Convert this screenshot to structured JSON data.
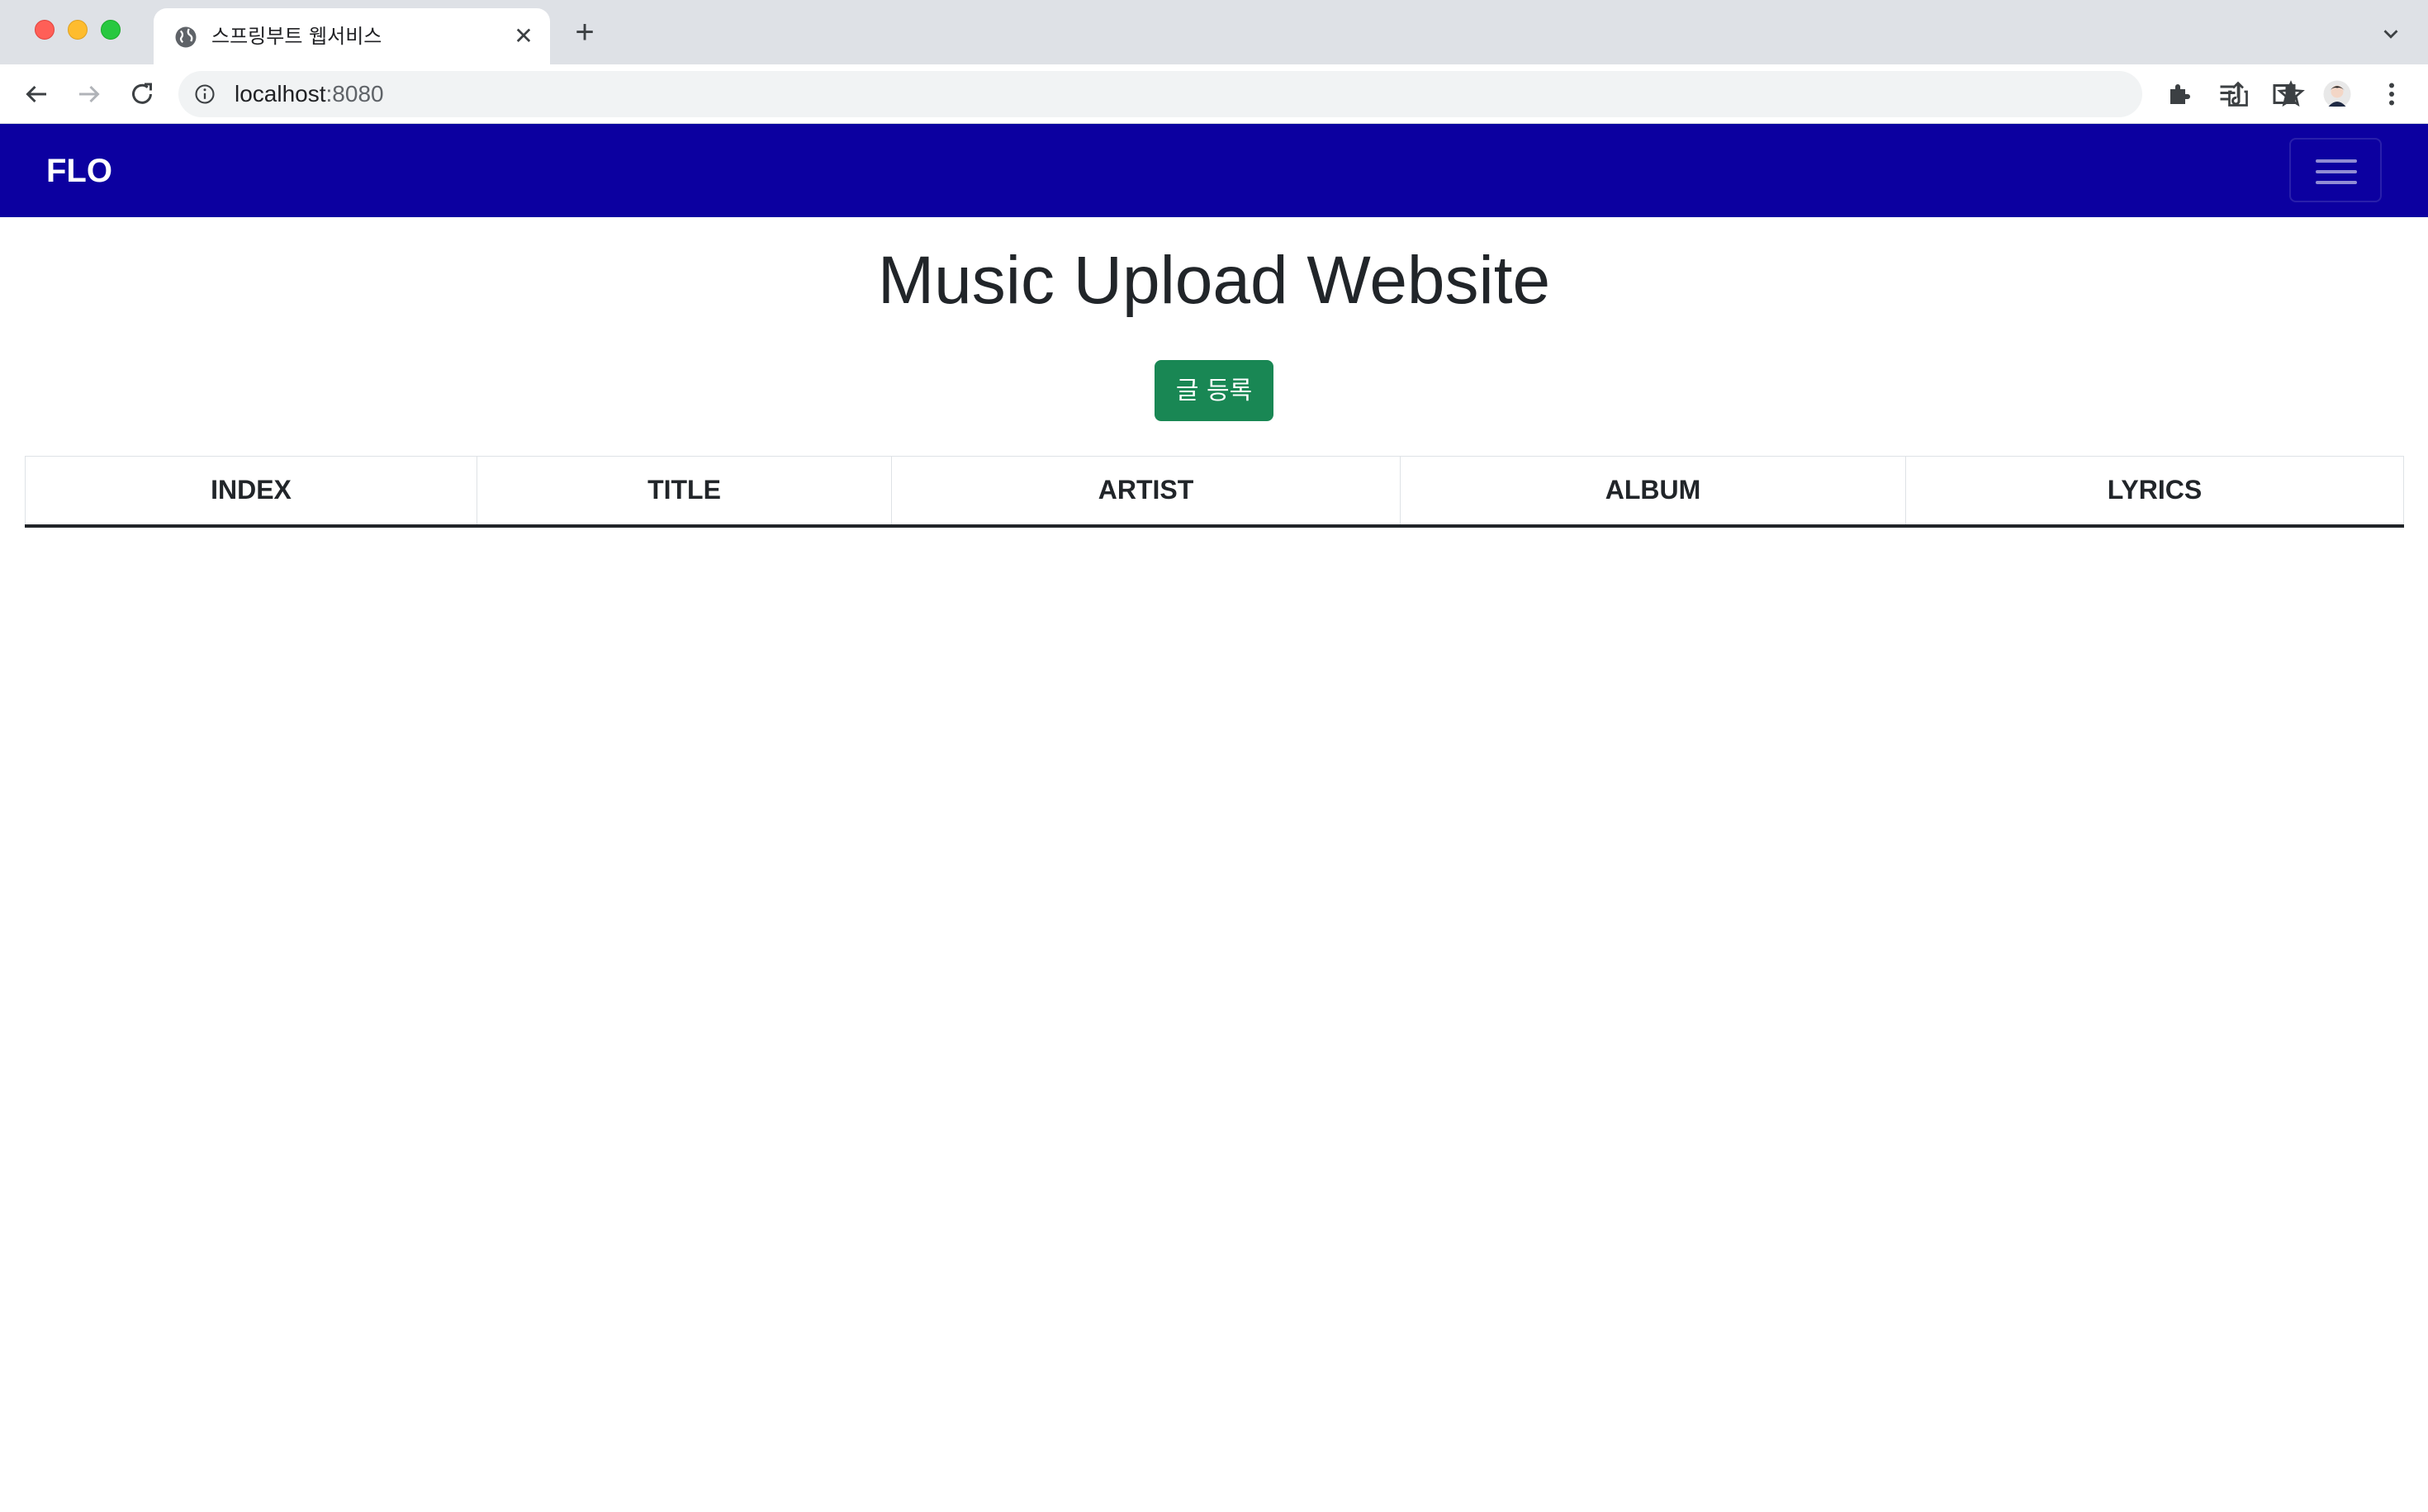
{
  "browser": {
    "tab_title": "스프링부트 웹서비스",
    "url_host": "localhost",
    "url_port": ":8080"
  },
  "navbar": {
    "brand": "FLO",
    "bg_color": "#0c00a0"
  },
  "main": {
    "title": "Music Upload Website",
    "add_button_label": "글 등록",
    "add_button_color": "#198754"
  },
  "table": {
    "columns": [
      "INDEX",
      "TITLE",
      "ARTIST",
      "ALBUM",
      "LYRICS"
    ],
    "rows": []
  }
}
